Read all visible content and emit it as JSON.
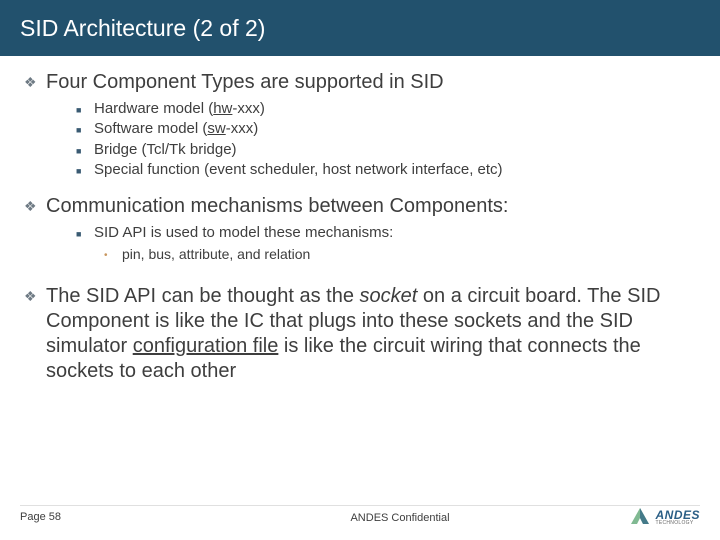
{
  "title": "SID Architecture (2 of 2)",
  "sections": {
    "a": {
      "heading": "Four Component Types are supported in SID",
      "items": {
        "0": {
          "pre": "Hardware model (",
          "u": "hw",
          "post": "-xxx)"
        },
        "1": {
          "pre": "Software model (",
          "u": "sw",
          "post": "-xxx)"
        },
        "2": {
          "text": "Bridge (Tcl/Tk bridge)"
        },
        "3": {
          "text": "Special function (event scheduler, host network interface, etc)"
        }
      }
    },
    "b": {
      "heading": "Communication mechanisms between Components:",
      "items": {
        "0": {
          "text": "SID API is used to model these mechanisms:"
        }
      },
      "sub": {
        "0": {
          "text": "pin, bus, attribute, and relation"
        }
      }
    },
    "c": {
      "pre": "The SID API can be thought as the ",
      "it": "socket",
      "mid": " on a circuit board. The SID Component is like the IC that plugs into these sockets and the SID simulator ",
      "u": "configuration file",
      "post": " is like the circuit wiring that connects the sockets to each other"
    }
  },
  "footer": {
    "page": "Page 58",
    "confidential": "ANDES Confidential",
    "logo_main": "ANDES",
    "logo_sub": "TECHNOLOGY"
  }
}
